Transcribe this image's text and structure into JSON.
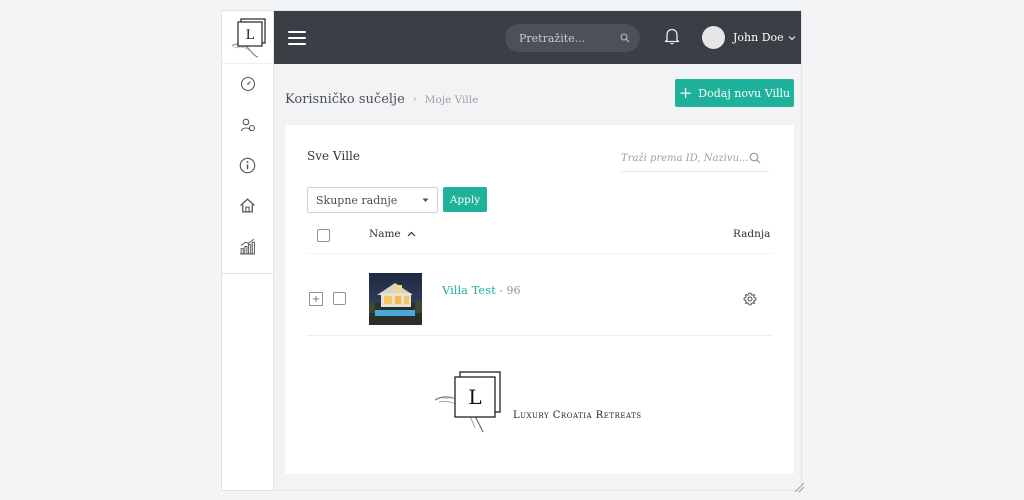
{
  "header": {
    "search_placeholder": "Pretražite...",
    "user_name": "John Doe"
  },
  "sidebar": {
    "logo_letter": "L",
    "items": [
      {
        "icon": "dashboard-icon"
      },
      {
        "icon": "users-icon"
      },
      {
        "icon": "info-icon"
      },
      {
        "icon": "home-icon"
      },
      {
        "icon": "chart-icon"
      }
    ]
  },
  "breadcrumb": {
    "main": "Korisničko sučelje",
    "current": "Moje Ville"
  },
  "add_button_label": "Dodaj novu Villu",
  "card": {
    "title": "Sve Ville",
    "search_placeholder": "Traži prema ID, Nazivu...",
    "bulk_select_value": "Skupne radnje",
    "apply_label": "Apply",
    "columns": {
      "name": "Name",
      "action": "Radnja"
    },
    "rows": [
      {
        "name": "Villa Test",
        "meta": " - 96"
      }
    ]
  },
  "brand": {
    "logo_letter": "L",
    "name": "Luxury Croatia Retreats"
  },
  "colors": {
    "accent": "#1fb29a",
    "topbar": "#3a3f45"
  }
}
